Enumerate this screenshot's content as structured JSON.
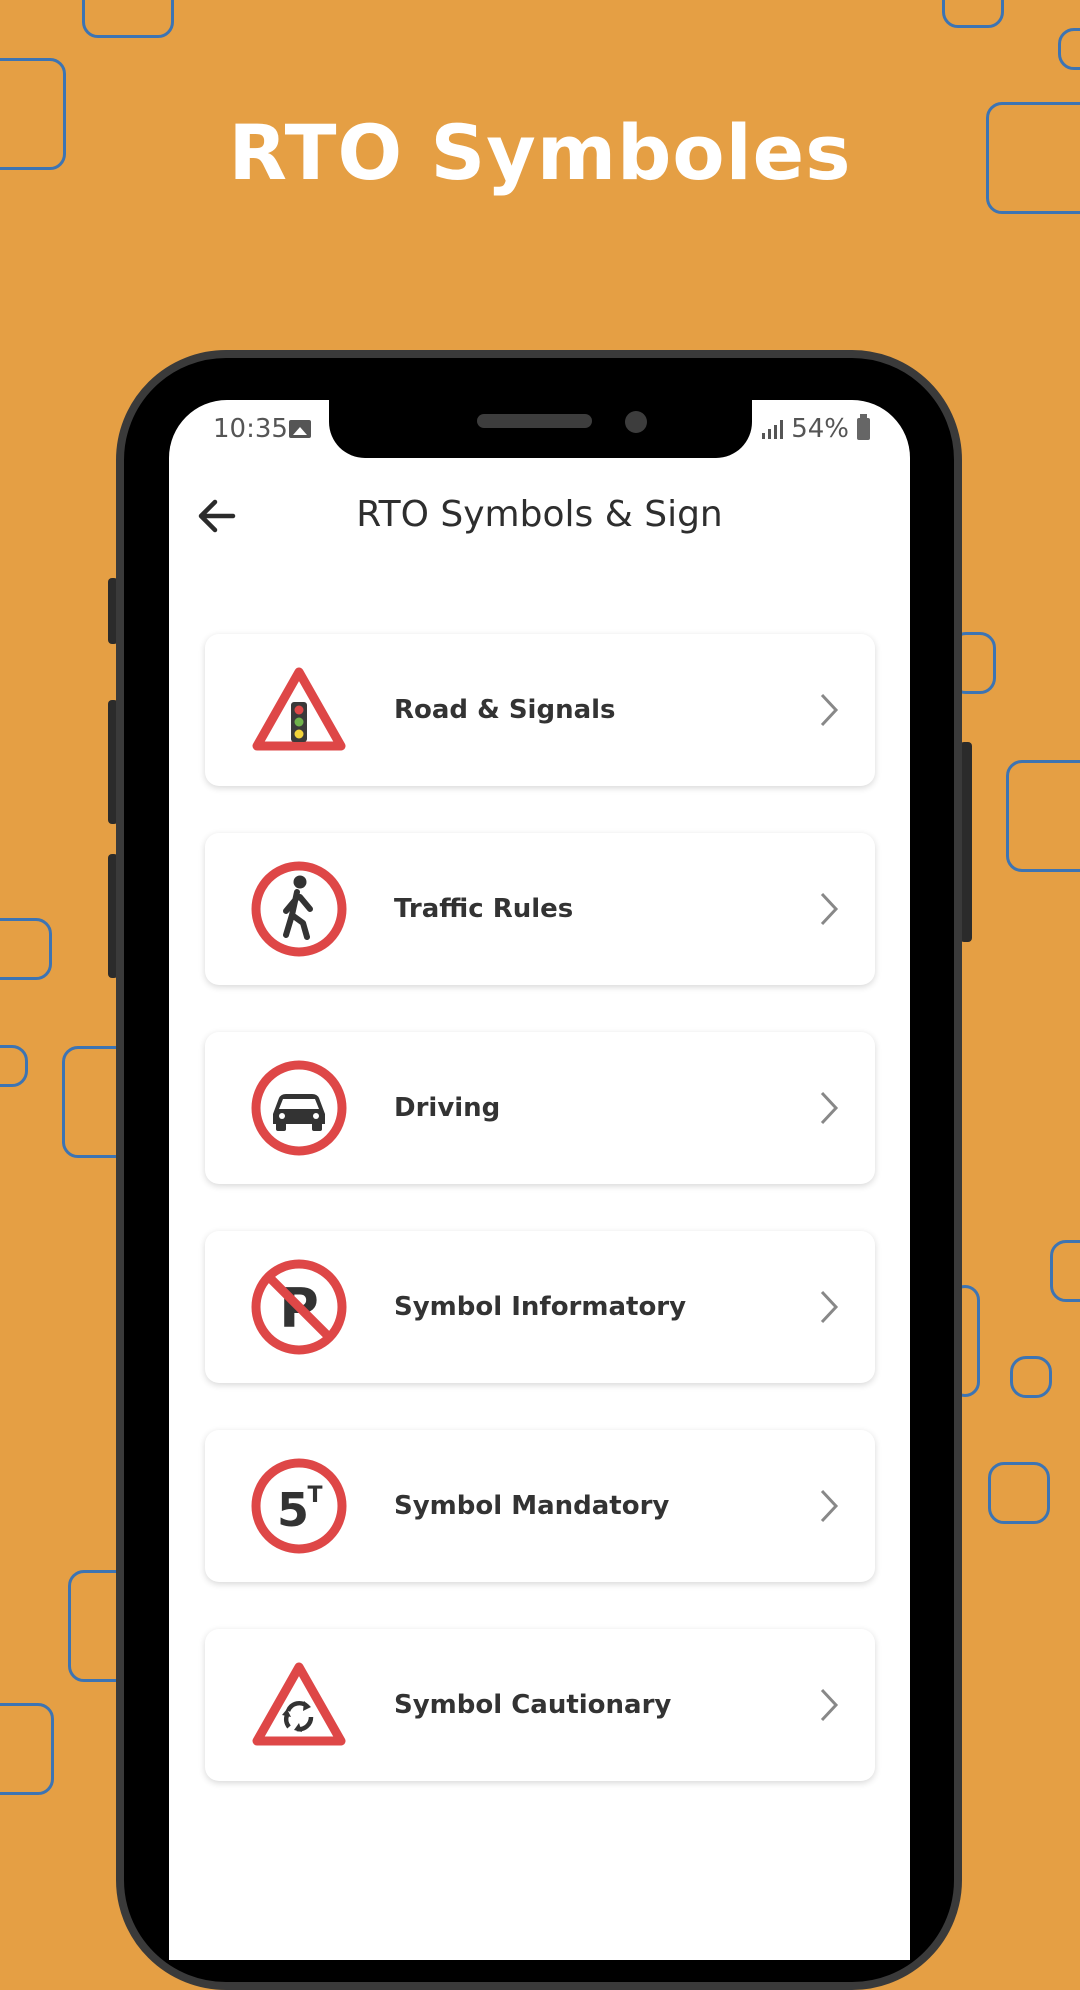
{
  "promo": {
    "headline": "RTO Symboles"
  },
  "status_bar": {
    "time": "10:35",
    "battery": "54%"
  },
  "header": {
    "title": "RTO Symbols & Sign"
  },
  "menu": {
    "items": [
      {
        "label": "Road & Signals",
        "icon": "traffic-light-warning-icon"
      },
      {
        "label": "Traffic Rules",
        "icon": "pedestrian-sign-icon"
      },
      {
        "label": "Driving",
        "icon": "car-sign-icon"
      },
      {
        "label": "Symbol Informatory",
        "icon": "no-parking-icon"
      },
      {
        "label": "Symbol Mandatory",
        "icon": "weight-limit-5t-icon"
      },
      {
        "label": "Symbol Cautionary",
        "icon": "roundabout-warning-icon"
      }
    ],
    "icon_text": {
      "parking": "P",
      "weight_value": "5",
      "weight_unit": "T"
    }
  },
  "colors": {
    "background": "#e59f44",
    "accent_red": "#de4747",
    "deco_outline": "#3d74b3"
  }
}
